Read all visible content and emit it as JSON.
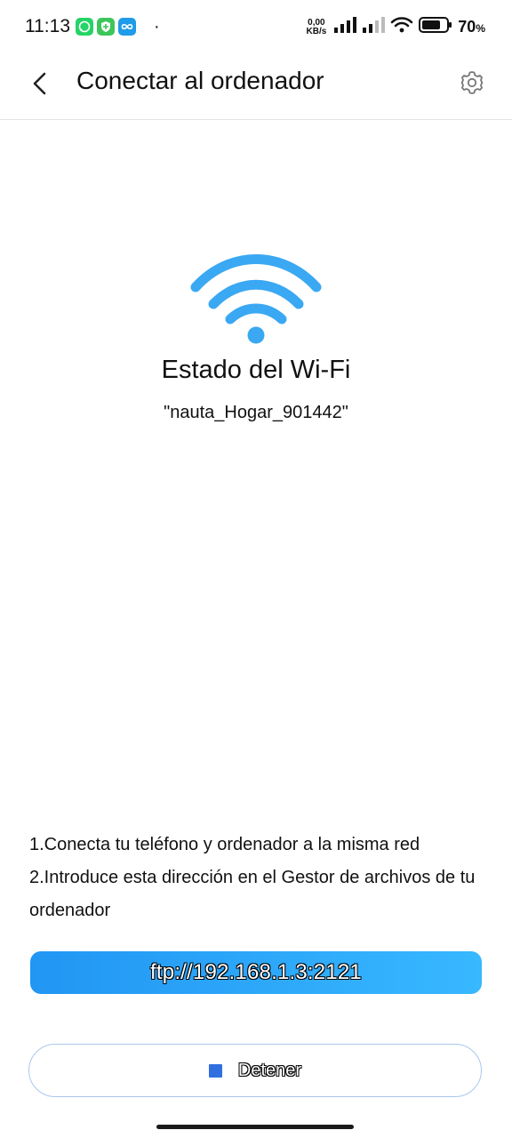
{
  "status_bar": {
    "time": "11:13",
    "net_speed_value": "0,00",
    "net_speed_unit": "KB/s",
    "battery_percent": "70",
    "battery_unit": "%",
    "dot": "·"
  },
  "app_bar": {
    "title": "Conectar al ordenador"
  },
  "wifi": {
    "title": "Estado del Wi-Fi",
    "ssid": "\"nauta_Hogar_901442\"",
    "accent_color": "#3AA8F2"
  },
  "instructions": {
    "step1": "1.Conecta tu teléfono y ordenador a la misma red",
    "step2": "2.Introduce esta dirección en el Gestor de archivos de tu ordenador"
  },
  "ftp": {
    "address": "ftp://192.168.1.3:2121"
  },
  "stop": {
    "label": "Detener"
  },
  "icons": {
    "back": "chevron-left-icon",
    "settings": "gear-icon",
    "wifi": "wifi-icon",
    "stop": "stop-square-icon"
  }
}
